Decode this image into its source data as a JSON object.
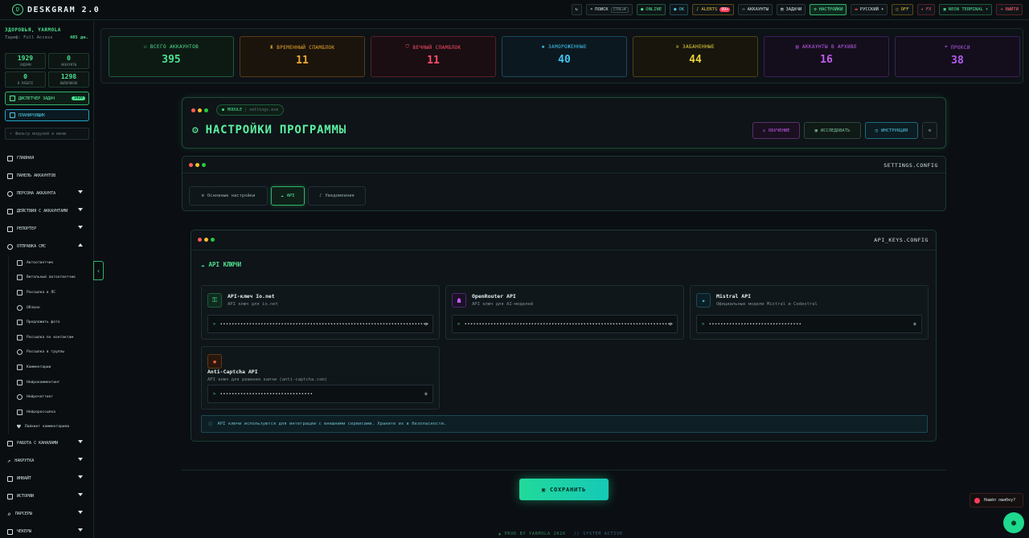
{
  "app": {
    "title": "DESKGRAM 2.0",
    "logo_letter": "D"
  },
  "topnav": {
    "search_label": "ПОИСК",
    "search_kbd": "CTRL+K",
    "online": "ONLINE",
    "ok": "OK",
    "alerts": "ALERTS",
    "alerts_count": "99+",
    "accounts": "АККАУНТЫ",
    "tasks": "ЗАДАЧИ",
    "settings": "НАСТРОЙКИ",
    "language": "РУССКИЙ",
    "off": "OFF",
    "fx": "FX",
    "terminal": "NEON TERMINAL",
    "logout": "ВЫЙТИ"
  },
  "user": {
    "name": "ЗДОРОВЬЯ, YARMOLA",
    "plan": "Тариф: Full Access",
    "days": "405 дн."
  },
  "side_stats": [
    {
      "value": "1929",
      "label": "ЗАДАЧИ"
    },
    {
      "value": "0",
      "label": "АККАУНТЫ"
    },
    {
      "value": "0",
      "label": "В РАБОТЕ"
    },
    {
      "value": "1298",
      "label": "ВЫПОЛНЕНО"
    }
  ],
  "dispatcher": {
    "label": "ДИСПЕТЧЕР ЗАДАЧ",
    "count": "1929"
  },
  "scheduler": {
    "label": "ПЛАНИРОВЩИК"
  },
  "filter": {
    "placeholder": "Фильтр модулей и меню"
  },
  "nav": [
    {
      "label": "ГЛАВНАЯ"
    },
    {
      "label": "ПАНЕЛЬ АККАУНТОВ"
    },
    {
      "label": "ПЕРСОНА АККАУНТА"
    },
    {
      "label": "ДЕЙСТВИЯ С АККАУНТАМИ"
    },
    {
      "label": "РЕПОРТЕР"
    },
    {
      "label": "ОТПРАВКА СМС"
    }
  ],
  "sub_nav": [
    {
      "label": "Автоответчик"
    },
    {
      "label": "Витальный автоответчик"
    },
    {
      "label": "Рассылка в ЛС"
    },
    {
      "label": "Обзвон"
    },
    {
      "label": "Предложить фото"
    },
    {
      "label": "Рассылка по контактам"
    },
    {
      "label": "Рассылка в группы"
    },
    {
      "label": "Комментарии"
    },
    {
      "label": "Нейрокомментинг"
    },
    {
      "label": "Нейрочаттинг"
    },
    {
      "label": "Нейрорассылка"
    },
    {
      "label": "Лайкинг комментариев"
    }
  ],
  "nav2": [
    {
      "label": "РАБОТА С КАНАЛАМИ"
    },
    {
      "label": "НАКРУТКА"
    },
    {
      "label": "ИНВАЙТ"
    },
    {
      "label": "ИСТОРИИ"
    },
    {
      "label": "ПАРСЕРЫ"
    },
    {
      "label": "ЧЕКЕРЫ"
    }
  ],
  "stats": [
    {
      "label": "ВСЕГО АККАУНТОВ",
      "value": "395",
      "color": "#4ce08f"
    },
    {
      "label": "ВРЕМЕННЫЙ СПАМБЛОК",
      "value": "11",
      "color": "#f0a830"
    },
    {
      "label": "ВЕЧНЫЙ СПАМБЛОК",
      "value": "11",
      "color": "#ff4d6a"
    },
    {
      "label": "ЗАМОРОЖЕННЫЕ",
      "value": "40",
      "color": "#3ec6f0"
    },
    {
      "label": "ЗАБАНЕННЫЕ",
      "value": "44",
      "color": "#e6d23c"
    },
    {
      "label": "АККАУНТЫ В АРХИВЕ",
      "value": "16",
      "color": "#c45cf0"
    },
    {
      "label": "ПРОКСИ",
      "value": "38",
      "color": "#b55cf0"
    }
  ],
  "module": {
    "tag": "MODULE",
    "file": "settings.exe",
    "title": "НАСТРОЙКИ ПРОГРАММЫ",
    "btn_learn": "ОБУЧЕНИЕ",
    "btn_research": "ИССЛЕДОВАТЬ",
    "btn_guide": "ИНСТРУКЦИЯ"
  },
  "settings_panel": {
    "tag": "SETTINGS.CONFIG",
    "tabs": [
      {
        "label": "Основные настройки"
      },
      {
        "label": "API"
      },
      {
        "label": "Уведомления"
      }
    ]
  },
  "api_panel": {
    "tag": "API_KEYS.CONFIG",
    "section_title": "API КЛЮЧИ",
    "cards": [
      {
        "title": "API-ключ Io.net",
        "subtitle": "API ключ для io.net",
        "masked": "••••••••••••••••••••••••••••••••••••••••••••••••••••••••••••••••••••••••"
      },
      {
        "title": "OpenRouter API",
        "subtitle": "API ключ для AI-моделей",
        "masked": "••••••••••••••••••••••••••••••••••••••••••••••••••••••••••••••••••••••••"
      },
      {
        "title": "Mistral API",
        "subtitle": "Официальные модели Mistral и Codestral",
        "masked": "••••••••••••••••••••••••••••••••"
      },
      {
        "title": "Anti-Captcha API",
        "subtitle": "API ключ для решения капчи (anti-captcha.com)",
        "masked": "••••••••••••••••••••••••••••••••"
      }
    ],
    "info": "API ключи используются для интеграции с внешними сервисами. Храните их в безопасности."
  },
  "save_label": "СОХРАНИТЬ",
  "footer": {
    "prod": "▲ PROD BY YARMOLA 2026",
    "sys": "// SYSTEM ACTIVE"
  },
  "bug_report": "Нашёл ошибку?",
  "colors": {
    "accent": "#4ce08f",
    "cyan": "#3ec6f0",
    "bg": "#0b0f13"
  }
}
